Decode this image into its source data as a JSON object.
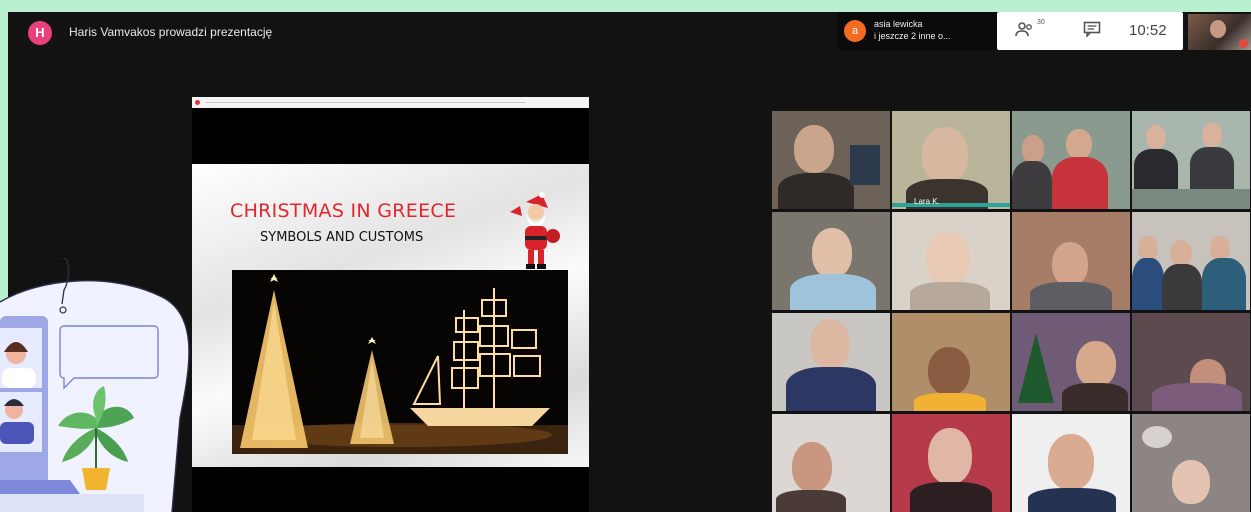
{
  "meeting": {
    "presenter_initial": "H",
    "presenter_banner": "Haris Vamvakos prowadzi prezentację",
    "participants": {
      "initial": "a",
      "line1": "asia lewicka",
      "line2": "i jeszcze 2 inne o..."
    },
    "people_count": "30",
    "clock": "10:52",
    "icons": [
      "people-icon",
      "chat-icon"
    ]
  },
  "slide": {
    "title": "CHRISTMAS IN GREECE",
    "subtitle": "SYMBOLS AND CUSTOMS"
  },
  "tiles": [
    {
      "name": "tile-1"
    },
    {
      "name": "tile-2",
      "label": "Lara K."
    },
    {
      "name": "tile-3"
    },
    {
      "name": "tile-4"
    },
    {
      "name": "tile-5"
    },
    {
      "name": "tile-6"
    },
    {
      "name": "tile-7"
    },
    {
      "name": "tile-8"
    },
    {
      "name": "tile-9"
    },
    {
      "name": "tile-10"
    },
    {
      "name": "tile-11"
    },
    {
      "name": "tile-12"
    },
    {
      "name": "tile-13"
    },
    {
      "name": "tile-14"
    },
    {
      "name": "tile-15"
    },
    {
      "name": "tile-16"
    }
  ],
  "colors": {
    "page_background": "#b9f0cf",
    "meet_background": "#121212",
    "presenter_avatar": "#e8407a",
    "participant_avatar": "#f26b21",
    "slide_title": "#e3262d"
  }
}
